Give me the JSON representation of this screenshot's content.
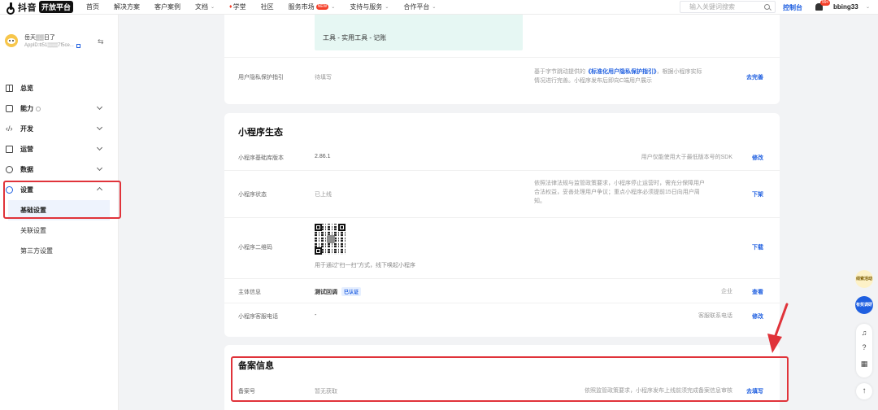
{
  "nav": {
    "logo_text": "抖音",
    "logo_badge": "开放平台",
    "items": [
      {
        "label": "首页",
        "caret": false
      },
      {
        "label": "解决方案",
        "caret": false
      },
      {
        "label": "客户案例",
        "caret": false
      },
      {
        "label": "文档",
        "caret": true
      },
      {
        "label": "学堂",
        "caret": false,
        "flame": true
      },
      {
        "label": "社区",
        "caret": false
      },
      {
        "label": "服务市场",
        "caret": true,
        "badge": "NEW"
      },
      {
        "label": "支持与服务",
        "caret": true
      },
      {
        "label": "合作平台",
        "caret": true
      }
    ],
    "search_placeholder": "输入关键词搜索",
    "console_label": "控制台",
    "bell_badge": "99+",
    "username": "bbing33"
  },
  "sidebar": {
    "app_name": "岳天▒▒日了",
    "app_id": "AppID:tt51▒▒▒7f5ce...",
    "menu": [
      {
        "label": "总览",
        "icon": "home-icon",
        "chev": false
      },
      {
        "label": "能力",
        "icon": "bag-icon",
        "chev": true,
        "info": true
      },
      {
        "label": "开发",
        "icon": "code-icon",
        "chev": true
      },
      {
        "label": "运营",
        "icon": "ops-icon",
        "chev": true
      },
      {
        "label": "数据",
        "icon": "data-icon",
        "chev": true
      },
      {
        "label": "设置",
        "icon": "settings-icon",
        "chev": true,
        "expanded": true
      }
    ],
    "sub_items": [
      "基础设置",
      "关联设置",
      "第三方设置"
    ]
  },
  "card1": {
    "tags": "工具 - 实用工具 - 记账",
    "privacy": {
      "label": "用户隐私保护指引",
      "value": "待填写",
      "desc_1a": "基于字节跳动提供的",
      "desc_link": "《标准化用户隐私保护指引》",
      "desc_1b": "，根据小程序实际",
      "desc_2": "情况进行完善。小程序发布后即向C端用户展示",
      "action": "去完善"
    }
  },
  "card2": {
    "title": "小程序生态",
    "rows": {
      "lib": {
        "label": "小程序基础库版本",
        "value": "2.86.1",
        "desc": "用户仅能使用大于最低版本号的SDK",
        "action": "修改"
      },
      "status": {
        "label": "小程序状态",
        "value": "已上线",
        "desc_1": "依照法律法规与监管政策要求，小程序停止运营时，需充分保障用户",
        "desc_2": "合法权益，妥善处理用户争议；重点小程序必须提前15日向用户周",
        "desc_3": "知。",
        "action": "下架"
      },
      "qrcode": {
        "label": "小程序二维码",
        "hint": "用于通过\"扫一扫\"方式，线下唤起小程序",
        "action": "下载"
      },
      "subject": {
        "label": "主体信息",
        "value": "测试回调",
        "badge": "已认证",
        "desc": "企业",
        "action": "查看"
      },
      "service": {
        "label": "小程序客服电话",
        "value": "-",
        "desc": "客服联系电话",
        "action": "修改"
      }
    }
  },
  "card3": {
    "title": "备案信息",
    "row": {
      "label": "备案号",
      "value": "暂无获取",
      "desc": "依照监管政策要求，小程序发布上线前须完成备案信息审核",
      "action": "去填写"
    }
  },
  "floaters": {
    "pill1": "线索活动",
    "pill2": "有奖调研"
  },
  "colors": {
    "accent": "#1f5fe0",
    "highlight": "#e0333a",
    "tag_bg": "#e6f7f3"
  }
}
